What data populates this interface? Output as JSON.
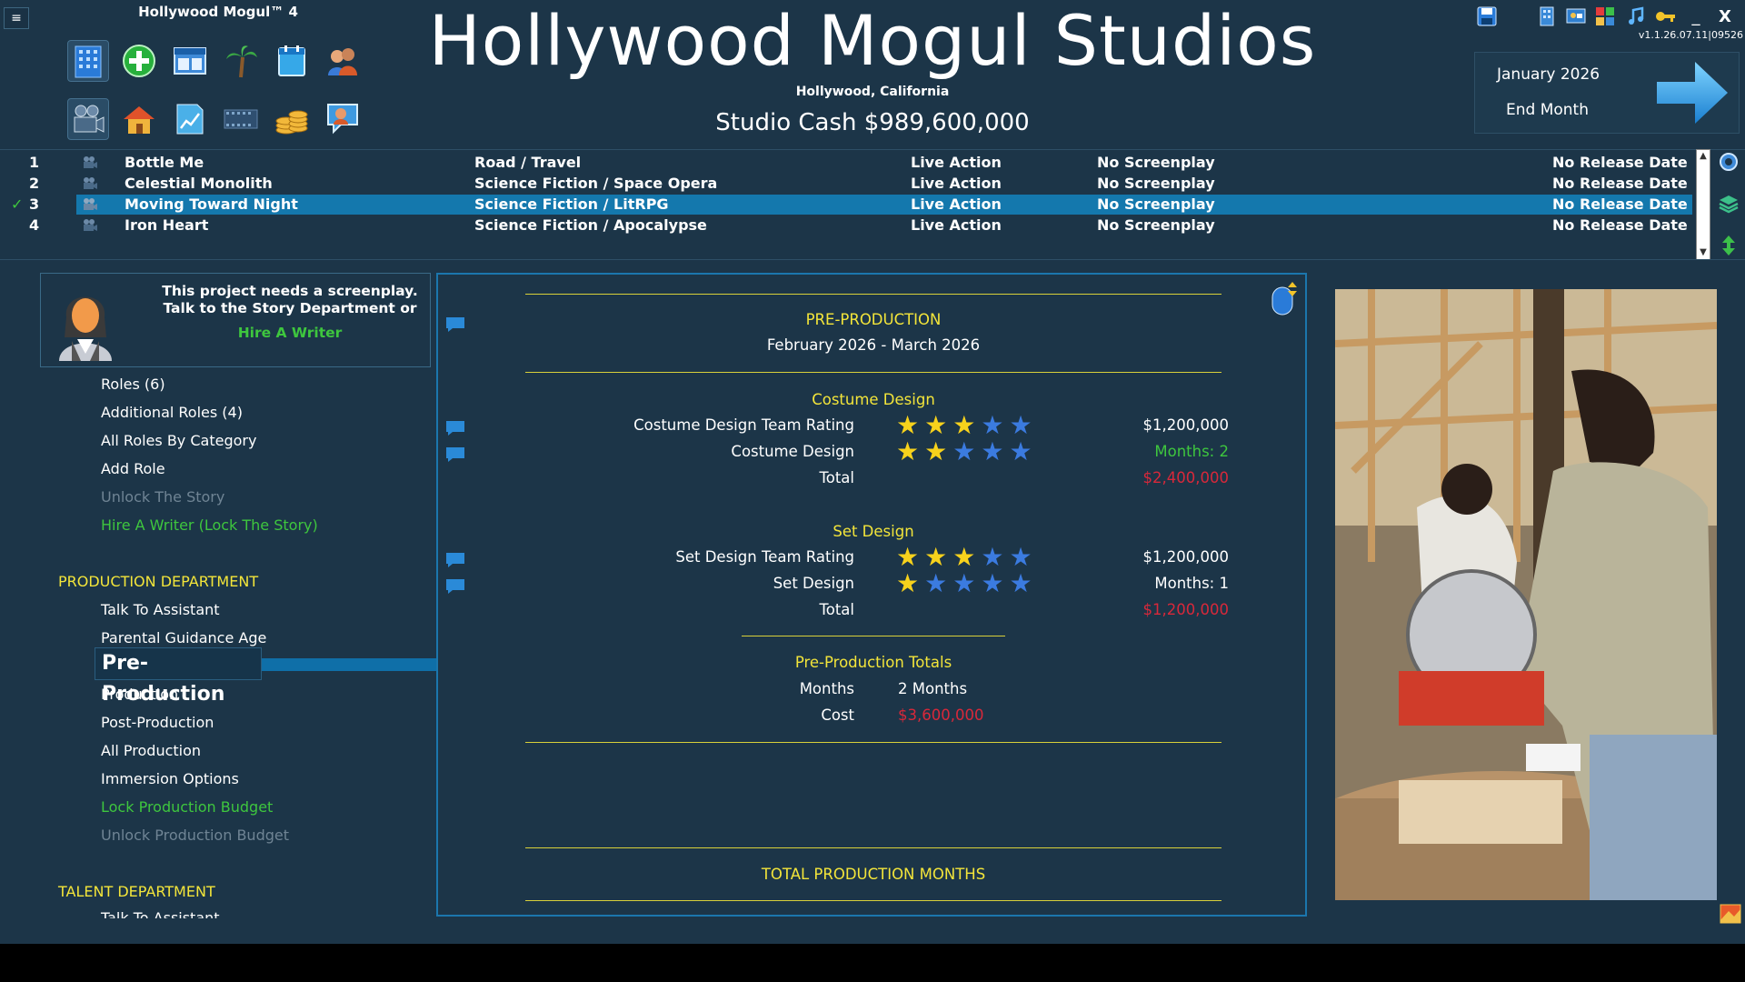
{
  "window": {
    "menu_label": "≡",
    "game_title": "Hollywood Mogul™ 4",
    "version": "v1.1.26.07.11|09526",
    "minimize_label": "_",
    "close_label": "X"
  },
  "studio": {
    "name": "Hollywood Mogul Studios",
    "location": "Hollywood, California",
    "cash_text": "Studio Cash $989,600,000"
  },
  "date_panel": {
    "date": "January 2026",
    "end_month_label": "End Month"
  },
  "toolbar": {
    "row1": [
      "studio-building-icon",
      "add-project-icon",
      "window-layout-icon",
      "palm-tree-icon",
      "calendar-icon",
      "people-icon"
    ],
    "row2": [
      "film-camera-icon",
      "house-icon",
      "chart-icon",
      "film-strip-icon",
      "coins-icon",
      "talk-icon"
    ]
  },
  "projects": [
    {
      "num": "1",
      "title": "Bottle Me",
      "genre": "Road / Travel",
      "type": "Live Action",
      "screenplay": "No Screenplay",
      "release": "No Release Date",
      "selected": false
    },
    {
      "num": "2",
      "title": "Celestial Monolith",
      "genre": "Science Fiction / Space Opera",
      "type": "Live Action",
      "screenplay": "No Screenplay",
      "release": "No Release Date",
      "selected": false
    },
    {
      "num": "3",
      "title": "Moving Toward Night",
      "genre": "Science Fiction / LitRPG",
      "type": "Live Action",
      "screenplay": "No Screenplay",
      "release": "No Release Date",
      "selected": true
    },
    {
      "num": "4",
      "title": "Iron Heart",
      "genre": "Science Fiction / Apocalypse",
      "type": "Live Action",
      "screenplay": "No Screenplay",
      "release": "No Release Date",
      "selected": false
    }
  ],
  "writer_notice": {
    "line1": "This project needs a screenplay.",
    "line2": "Talk to the Story Department or",
    "hire_label": "Hire A Writer"
  },
  "left_menu": {
    "roles": "Roles (6)",
    "additional_roles": "Additional Roles (4)",
    "all_roles": "All Roles By Category",
    "add_role": "Add Role",
    "unlock_story": "Unlock The Story",
    "hire_writer_lock": "Hire A Writer (Lock The Story)",
    "production_header": "PRODUCTION DEPARTMENT",
    "talk_assistant": "Talk To Assistant",
    "parental_guidance": "Parental Guidance Age",
    "pre_production": "Pre-Production",
    "production": "Production",
    "post_production": "Post-Production",
    "all_production": "All Production",
    "immersion": "Immersion Options",
    "lock_budget": "Lock Production Budget",
    "unlock_budget": "Unlock Production Budget",
    "talent_header": "TALENT DEPARTMENT",
    "talent_talk": "Talk To Assistant"
  },
  "preproduction": {
    "header": "PRE-PRODUCTION",
    "dates": "February 2026 - March 2026",
    "costume": {
      "header": "Costume Design",
      "team_label": "Costume Design Team Rating",
      "team_stars": 3,
      "team_cost": "$1,200,000",
      "design_label": "Costume Design",
      "design_stars": 2,
      "design_months": "Months: 2",
      "total_label": "Total",
      "total_value": "$2,400,000"
    },
    "set": {
      "header": "Set Design",
      "team_label": "Set Design Team Rating",
      "team_stars": 3,
      "team_cost": "$1,200,000",
      "design_label": "Set Design",
      "design_stars": 1,
      "design_months": "Months: 1",
      "total_label": "Total",
      "total_value": "$1,200,000"
    },
    "totals": {
      "header": "Pre-Production Totals",
      "months_label": "Months",
      "months_value": "2 Months",
      "cost_label": "Cost",
      "cost_value": "$3,600,000"
    },
    "total_months_header": "TOTAL PRODUCTION MONTHS"
  },
  "colors": {
    "background": "#1c3548",
    "selection": "#1478ad",
    "yellow": "#f3e53a",
    "green": "#3ec63e",
    "red": "#d8283a"
  }
}
